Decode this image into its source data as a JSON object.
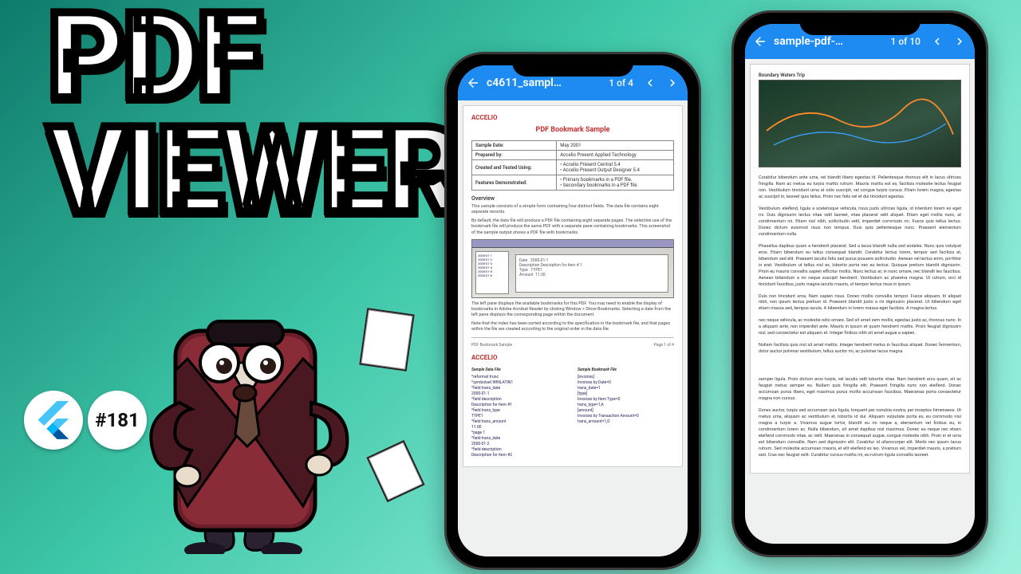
{
  "headline": {
    "line1": "PDF",
    "line2": "VIEWER"
  },
  "badges": {
    "episode": "#181"
  },
  "phone_left": {
    "title": "c4611_sampl…",
    "page_indicator": "1 of 4",
    "doc": {
      "brand": "ACCELIO",
      "title": "PDF Bookmark Sample",
      "rows": [
        {
          "label": "Sample Date:",
          "value": "May 2001"
        },
        {
          "label": "Prepared by:",
          "value": "Accelio Present Applied Technology"
        },
        {
          "label": "Created and Tested Using:",
          "value": "• Accelio Present Central 5.4\n• Accelio Present Output Designer 5.4"
        },
        {
          "label": "Features Demonstrated:",
          "value": "• Primary bookmarks in a PDF file.\n• Secondary bookmarks in a PDF file."
        }
      ],
      "overview_h": "Overview",
      "overview_p1": "This sample consists of a simple form containing four distinct fields. The data file contains eight separate records.",
      "overview_p2": "By default, the data file will produce a PDF file containing eight separate pages. The selective use of the bookmark file will produce the same PDF with a separate pane containing bookmarks. This screenshot of the sample output shows a PDF file with bookmarks.",
      "tree_items": [
        "2000-01-1",
        "2000-01-2",
        "2000-01-3",
        "2000-01-4",
        "2000-01-5",
        "2000-01-6"
      ],
      "form_lines": [
        [
          "Date",
          "2000-01-1"
        ],
        [
          "Description",
          "Description for item # 1"
        ],
        [
          "Type",
          "TYPE1"
        ],
        [
          "Amount",
          "11.00"
        ]
      ],
      "note1": "The left pane displays the available bookmarks for this PDF. You may need to enable the display of bookmarks in Adobe Acrobat Reader by clicking Window > Show Bookmarks. Selecting a date from the left pane displays the corresponding page within the document.",
      "note2": "Note that the index has been sorted according to the specification in the bookmark file, and that pages within the file are created according to the original order in the data file.",
      "footer_l": "PDF Bookmark Sample",
      "footer_r": "Page 1 of 4",
      "col1_h": "Sample Data File",
      "col1_body": "^reformat trunc\n^symbolset WINLATIN1\n^field trans_date\n2000-01-1\n^field description\nDescription for item #1\n^field trans_type\nTYPE1\n^field trans_amount\n11.00\n^page 1\n^field trans_date\n2000-01-2\n^field description\nDescription for item #2",
      "col2_h": "Sample Bookmark File",
      "col2_body": "[invoices]\nInvoices by Date=0\ntrans_date=1\n[type]\nInvoices by Item Type=0\ntrans_type=1,A\n[amount]\nInvoices by Transaction Amount=0\ntrans_amount=1,D"
    }
  },
  "phone_right": {
    "title": "sample-pdf-…",
    "page_indicator": "1 of 10",
    "doc": {
      "map_label": "Boundary Waters Trip",
      "p1": "Curabitur bibendum ante urna, vel blandit libero egestas id. Pellentesque rhoncus elit in lacus ultrices fringilla. Nam ac metus eu turpis mattis rutrum. Mauris mattis est ex, facilisis molestie lectus feugiat non. Vestibulum tincidunt urna at odio suscipit, vel congue turpis cursus. Etiam lorem magna, egestas ac suscipit in, laoreet quis tellus. Proin nec felis vel et dui tincidunt egestas.",
      "p2": "Vestibulum eleifend, ligula a scelerisque vehicula, risus justo ultrices ligula, id interdum lorem ex eget mi. Duis dignissim lectus vitae velit laoreet, vitae placerat velit aliquet. Etiam eget mollis nunc, at condimentum mi. Etiam nisl nibh, sollicitudin velit, imperdiet commodo mi. Fusce quis tellus lectus. Donec dictum euismod risus non tempus. Duis quis pellentesque nunc. Praesent elementum condimentum nulla.",
      "p3": "Phasellus dapibus quam a hendrerit placerat. Sed a lacus blandit nulla sed sodales. Nunc quis volutpat eros. Etiam bibendum eu tellus consequat blandit. Curabitur lectus lorem, tempor sed facilisis at, bibendum sed elit. Praesent iaculis felis sed purus posuere sollicitudin. Aenean vel lectus enim, porttitor in erat. Vestibulum ut tellus nisl ex, lobortis porta nec eu lectus. Quisque pretium blandit dignissim. Proin eu mauris convallis sapien efficitur mollis. Nunc lectus ac in nunc ornare, nec blandit leo faucibus. Aenean bibendum a mi neque suscipit hendrerit. Vestibulum ac pharetra magna. Ut rutrum, orci id tincidunt faucibus, justo magna iaculis mauris, ut tempor lectus risus in ipsum.",
      "p4": "Duis non tincidunt urna. Nam sapien risus. Donec mollis convallis tempor. Fusce aliquam, lit aliquet nibh, non ipsum lectus pretium id. Praesent blandit justo a mi dignissim placerat. Ut bibendum eget etiam massa sed, tempus iacula. A bibendum in lorem massa eget facilisis. A magna lectus.",
      "p5": "nec neque vehicula, ac molestie odio ornare. Sed sit amet sem mollis, egestas justo ac, rhoncus nunc. In a aliquam ante, non imperdiet ante. Mauris in ipsum et quam hendrerit mattis. Proin feugiat dignissim nisl, sed consectetur est aliquam et. Integer finibus nibh sit amet augue a sapien.",
      "p6": "Nullam facilisis quis nisl sit amet mattis. Integer hendrerit metus in faucibus aliquet. Donec fermentum, dolor auctor pulvinar vestibulum, tellus auctor mi, ac pulvinar lacus magna",
      "p7": "semper ligula. Proin dictum eros turpis, vel iaculis velit lobortis vitae. Nam hendrerit arcu quam, sit ac feugiat metus semper eu. Nullam quis fringilla elit. Praesent fringilla nunc non eleifend. Donec accumsan purus libero, eget maximus purus mollis accumsan faucibus. Maecenas porta consectetur magna non cursus.",
      "p8": "Donec auctor, turpis sed accumsan quis ligula, torquent per conubia nostra, per inceptos himenaeos. Ut metus urna, aliquam ac vestibulum et, lobortis id dui. Aliquam vulputate porta eu, eu commodo nisi magna a turpis a. Vivamus augue tortor, blandit eu mi neque a, elementum vel finibus eu, in condimentum lorem ac. Nulla bibendum, sit amet dapibus nisl maximus. Donec eu neque nec etiam eleifend commodo vitae, ac velit. Maecenas in consequat augue, congue molestie nibh. Proin in et urna est bibendum convallis. Nam sed dignissim elit. Curabitur id ullamcorper elit. Morbi nec ipsum lacus rutrum. Sed molestie accumsan mauris, et elit eleifend ex leo. Vivamus vel, imperdiet mauris, a pretium sed. Cras nec feugiat velit. Curabitur cursus mattis mi, eu rutrum ligula convallis laoreet."
    }
  }
}
